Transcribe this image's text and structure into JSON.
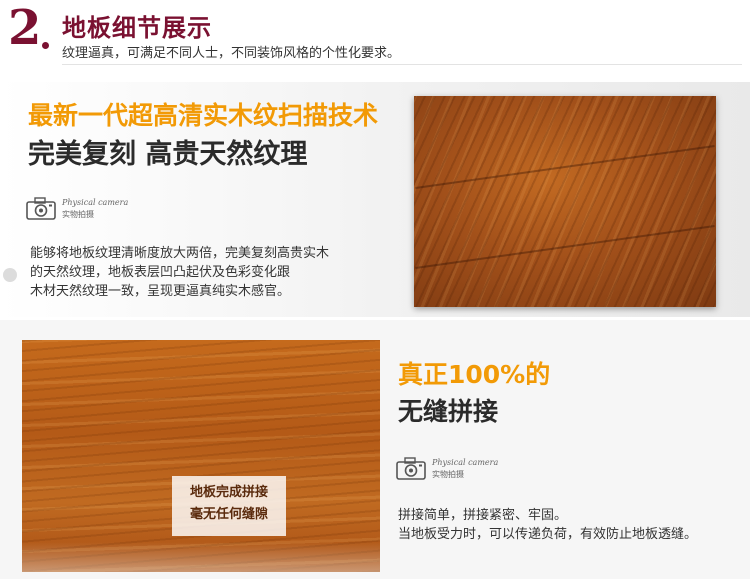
{
  "header": {
    "number": "2",
    "title": "地板细节展示",
    "subtitle": "纹理逼真，可满足不同人士，不同装饰风格的个性化要求。"
  },
  "section1": {
    "title": "最新一代超高清实木纹扫描技术",
    "subtitle": "完美复刻 高贵天然纹理",
    "camera_label_en": "Physical camera",
    "camera_label_cn": "实物拍摄",
    "body": [
      "能够将地板纹理清晰度放大两倍，完美复刻高贵实木",
      "的天然纹理，地板表层凹凸起伏及色彩变化跟",
      "木材天然纹理一致，呈现更逼真纯实木感官。"
    ]
  },
  "section2": {
    "title": "真正100%的",
    "subtitle": "无缝拼接",
    "overlay_text": [
      "地板完成拼接",
      "毫无任何缝隙"
    ],
    "camera_label_en": "Physical camera",
    "camera_label_cn": "实物拍摄",
    "body": [
      "拼接简单，拼接紧密、牢固。",
      "当地板受力时，可以传递负荷，有效防止地板透缝。"
    ]
  },
  "colors": {
    "brand": "#7a1131",
    "accent_orange": "#f29a06",
    "dark_text": "#2b2b2b"
  }
}
